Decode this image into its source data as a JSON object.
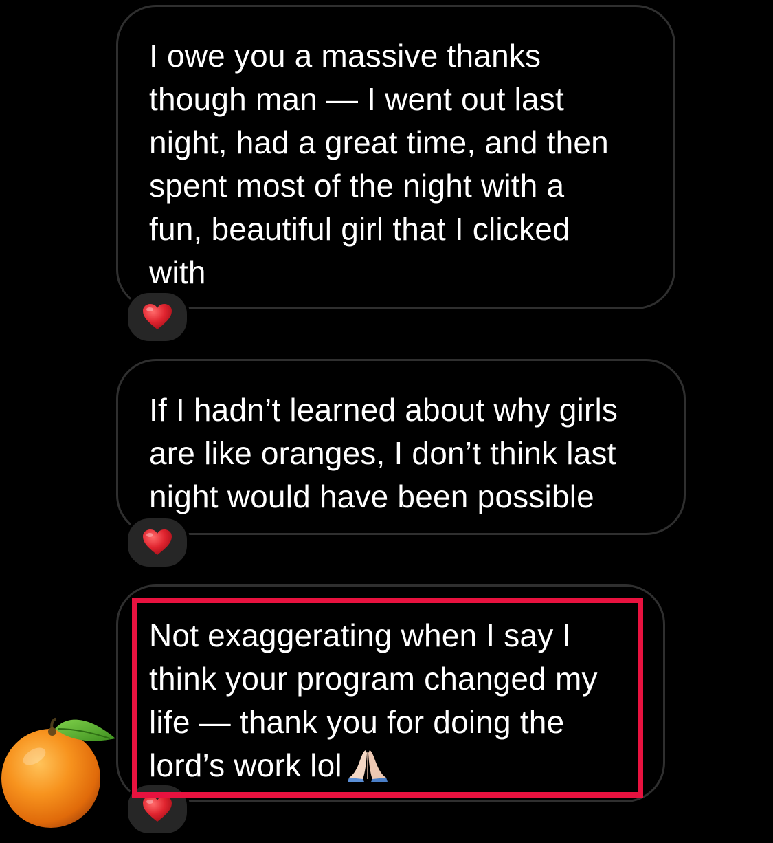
{
  "conversation": {
    "messages": [
      {
        "text": "I owe you a massive thanks\nthough man — I went out last\nnight, had a great time, and then\nspent most of the night with a\nfun, beautiful girl that I clicked\nwith",
        "reaction": "red-heart"
      },
      {
        "text": "If I hadn’t learned about why girls\nare like oranges, I don’t think last\nnight would have been possible",
        "reaction": "red-heart"
      },
      {
        "text": "Not exaggerating when I say I\nthink your program changed my\nlife — thank you for doing the\nlord’s work lol",
        "trailing_emoji": "folded-hands",
        "reaction": "red-heart",
        "highlighted": true
      }
    ],
    "sender_avatar": "orange-emoji"
  },
  "colors": {
    "background": "#000000",
    "bubble_border": "#2f2f2f",
    "text": "#ffffff",
    "reaction_pill": "#262626",
    "highlight": "#e8123f",
    "heart": "#e0242f"
  }
}
